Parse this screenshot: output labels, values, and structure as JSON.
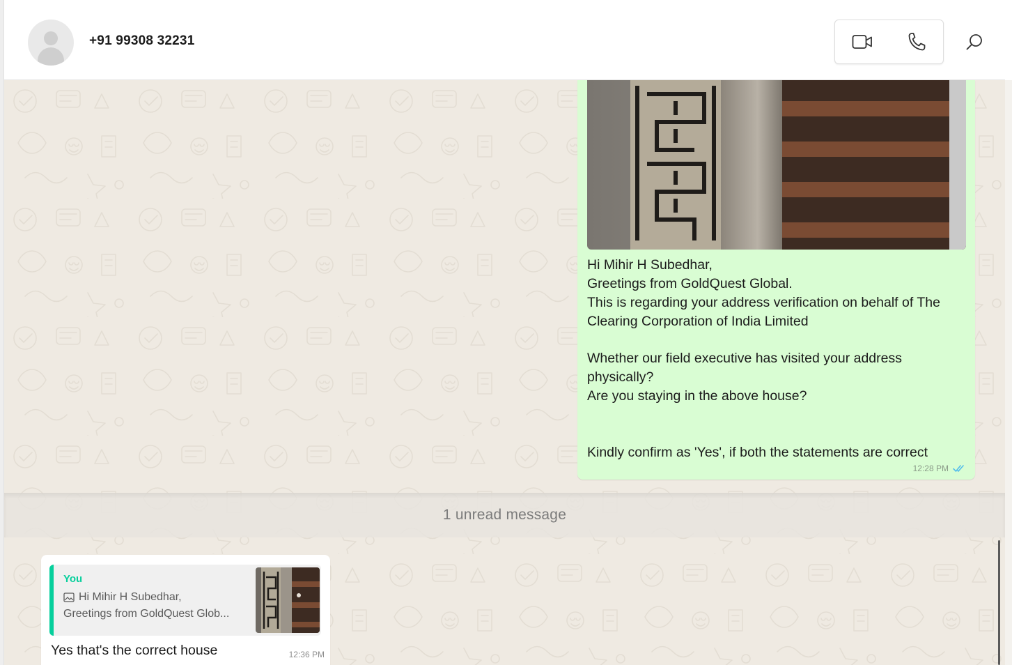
{
  "header": {
    "contact_name": "+91 99308 32231",
    "icons": {
      "avatar": "person-icon",
      "video": "video-camera-icon",
      "voice": "phone-icon",
      "search": "search-icon"
    }
  },
  "chat": {
    "outgoing_message": {
      "lines": [
        "Hi Mihir H Subedhar,",
        "Greetings from GoldQuest Global.",
        "This is regarding your address verification on behalf of The Clearing Corporation of India Limited"
      ],
      "lines_2": [
        "Whether our field executive has visited your address physically?",
        "Are you staying in the above house?"
      ],
      "lines_3": [
        "Kindly confirm as 'Yes', if both the statements are correct"
      ],
      "time": "12:28 PM",
      "status_icon": "double-check-icon",
      "status_color": "#53bdeb"
    },
    "unread_divider": "1 unread message",
    "incoming_message": {
      "quoted": {
        "author": "You",
        "line1": "Hi Mihir H Subedhar,",
        "line2": "Greetings from GoldQuest Glob...",
        "icon": "image-icon"
      },
      "text": "Yes that's the correct house",
      "time": "12:36 PM"
    }
  },
  "colors": {
    "outgoing_bubble": "#d9fdd3",
    "incoming_bubble": "#ffffff",
    "chat_background": "#efeae2",
    "quote_accent": "#06cf9c"
  }
}
